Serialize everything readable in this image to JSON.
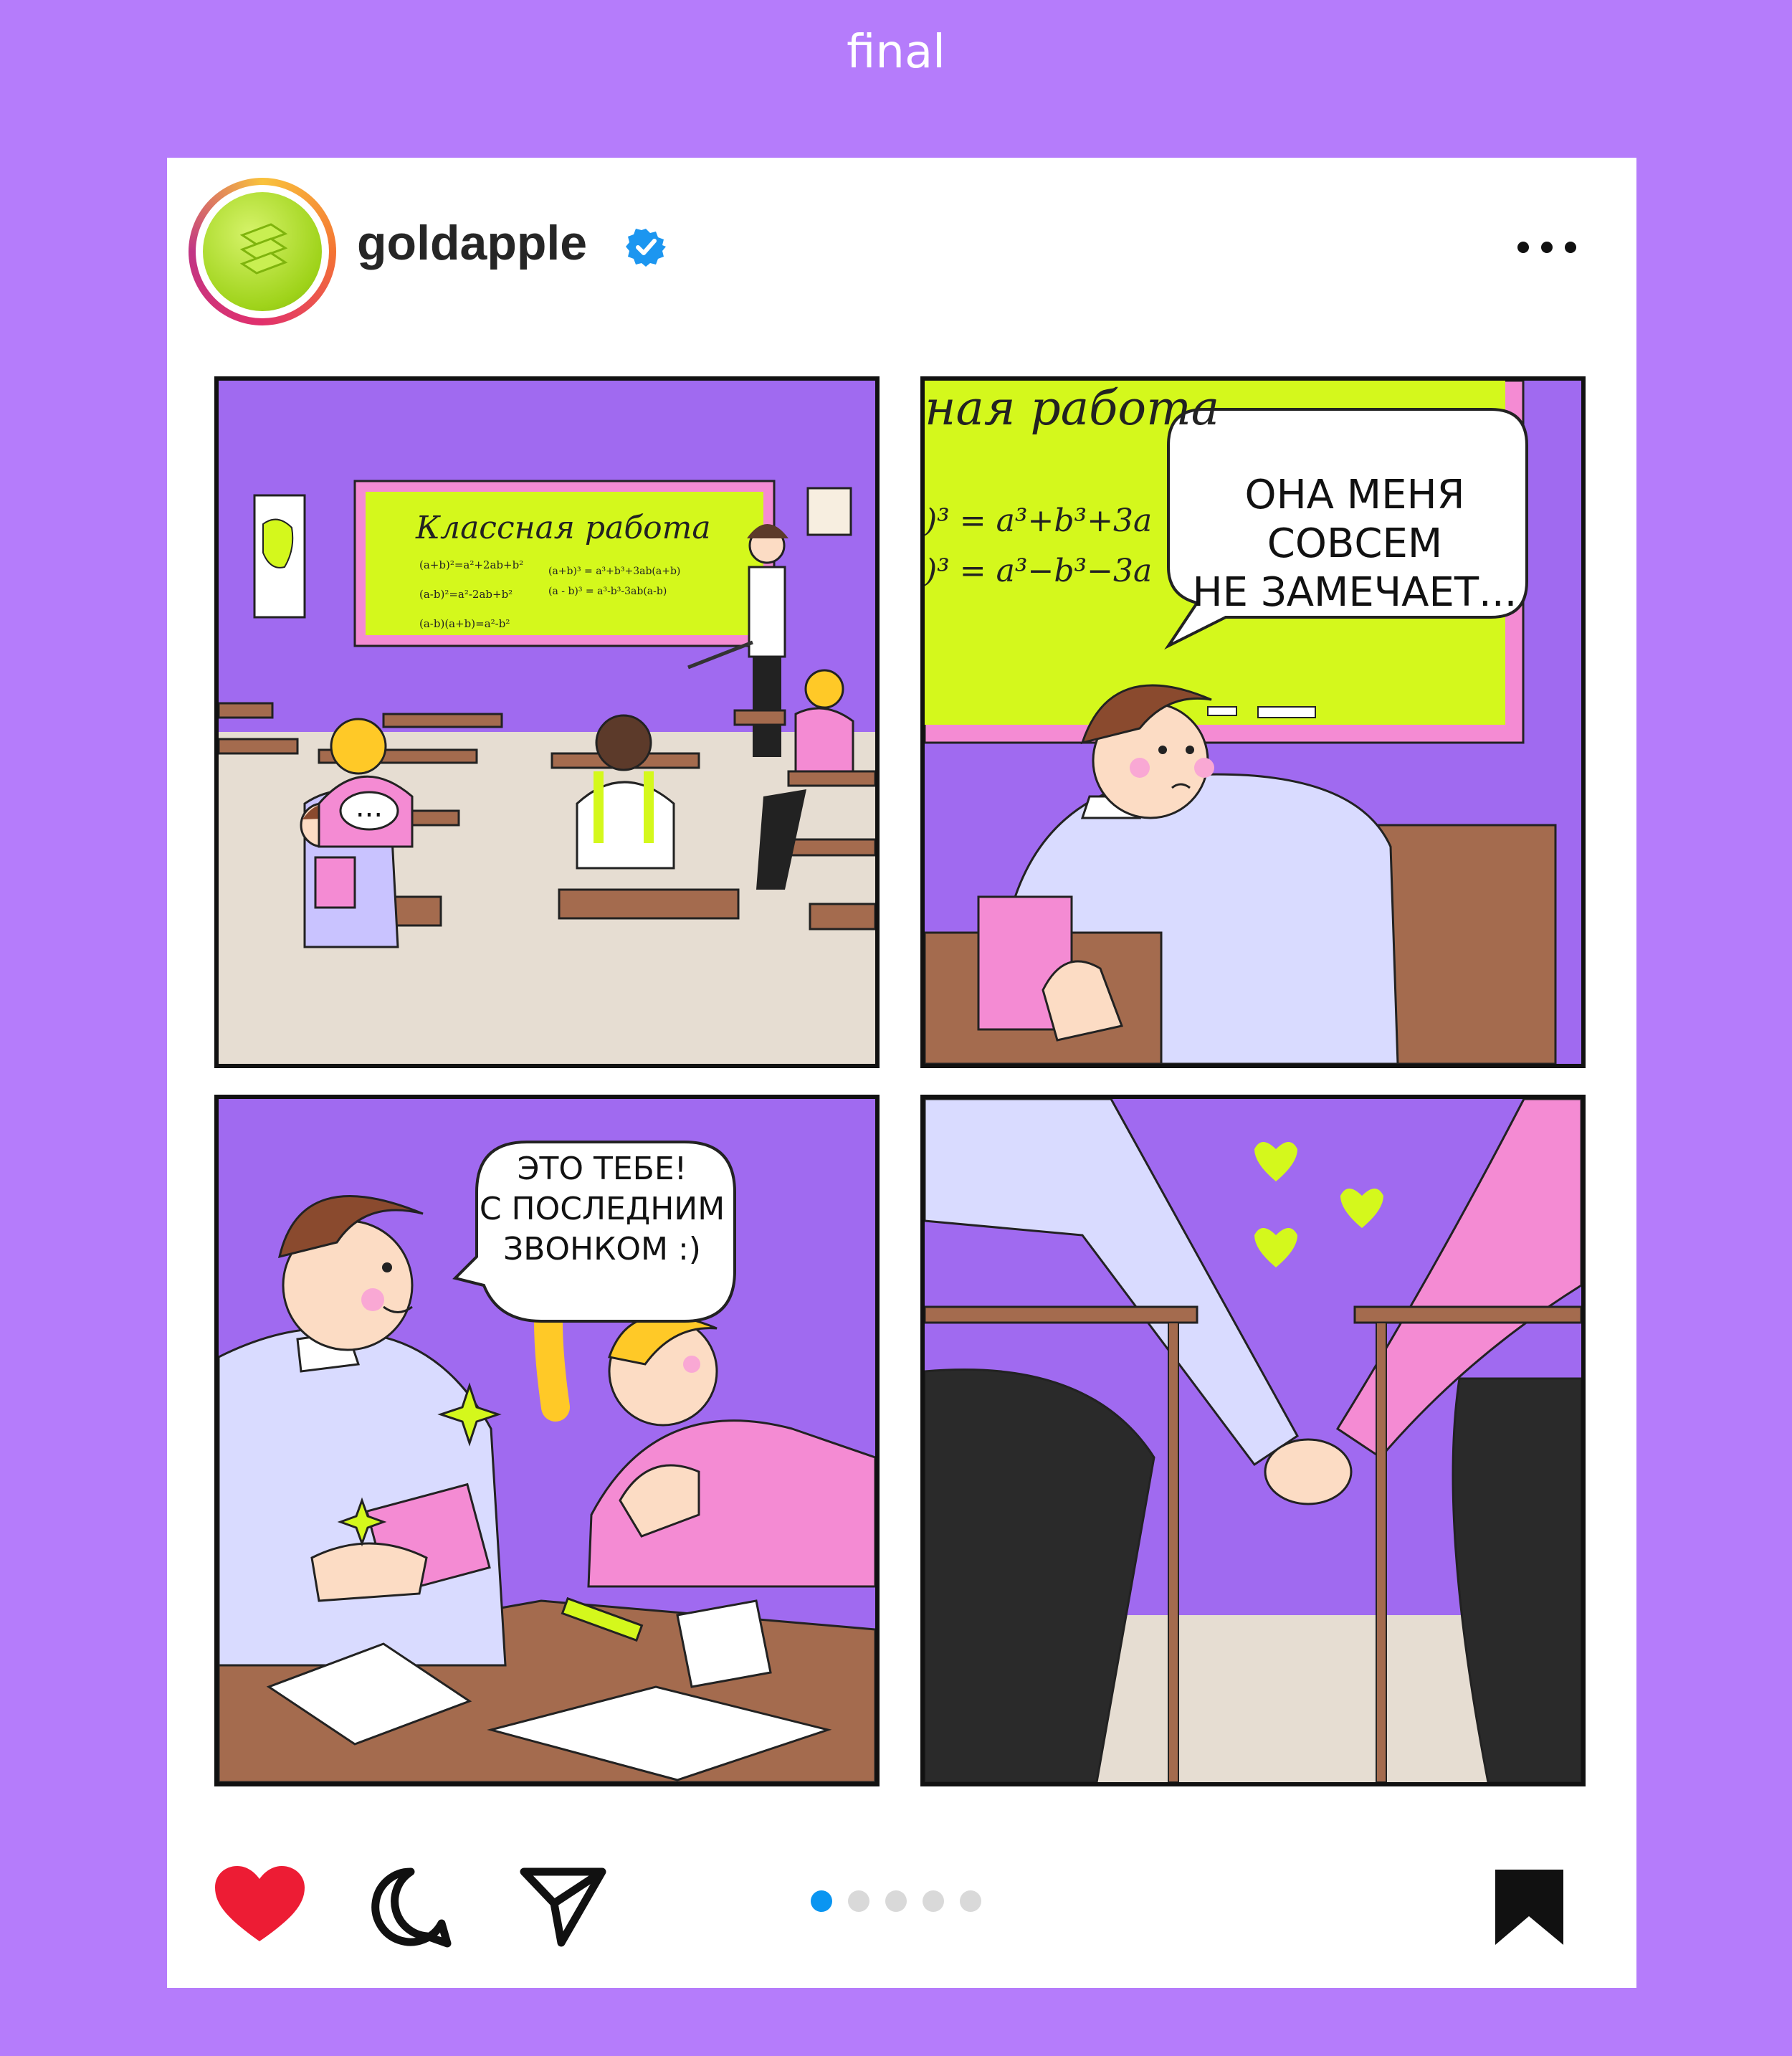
{
  "page": {
    "label": "final"
  },
  "post": {
    "username": "goldapple",
    "verified": true,
    "more_icon": "more-horizontal-icon",
    "carousel": {
      "current": 1,
      "total": 5
    }
  },
  "panels": {
    "panel1": {
      "board_title": "Классная работа",
      "formulas_left": [
        "(a+b)²=a²+2ab+b²",
        "(a-b)²=a²-2ab+b²",
        "(a-b)(a+b)=a²-b²"
      ],
      "formulas_right": [
        "(a+b)³ = a³+b³+3ab(a+b)",
        "(a - b)³ = a³-b³-3ab(a-b)"
      ],
      "speech": "..."
    },
    "panel2": {
      "board_title": "ная работа",
      "formula_1": ")³ = a³+b³+3a",
      "formula_2": ")³ = a³−b³−3a",
      "speech_line1": "ОНА МЕНЯ",
      "speech_line2": "СОВСЕМ",
      "speech_line3": "НЕ ЗАМЕЧАЕТ..."
    },
    "panel3": {
      "speech_line1": "ЭТО ТЕБЕ!",
      "speech_line2": "С ПОСЛЕДНИМ",
      "speech_line3": "ЗВОНКОМ :)"
    }
  },
  "actions": {
    "like_icon": "heart-filled-icon",
    "comment_icon": "comment-icon",
    "share_icon": "send-icon",
    "save_icon": "bookmark-filled-icon"
  },
  "colors": {
    "background": "#b57cfb",
    "board": "#d4f81c",
    "pink": "#f48bd3",
    "like": "#ed1c34",
    "active_dot": "#0a95f1"
  }
}
